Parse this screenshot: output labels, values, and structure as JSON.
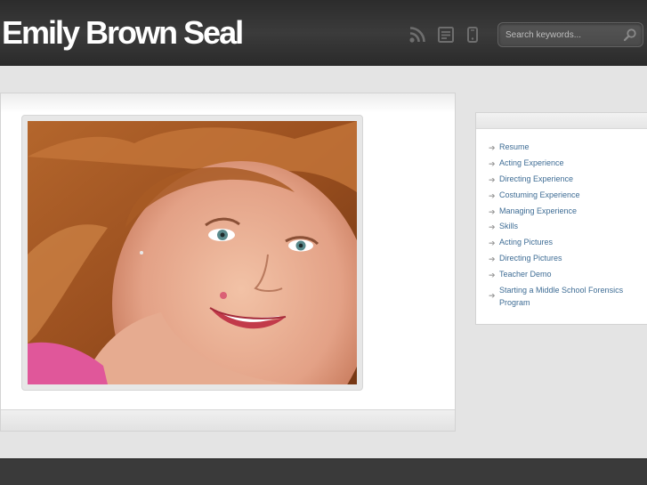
{
  "header": {
    "site_title": "Emily Brown Seal",
    "icons": [
      "rss-icon",
      "document-icon",
      "mobile-icon"
    ],
    "search": {
      "placeholder": "Search keywords..."
    }
  },
  "main": {
    "photo": {
      "subject": "portrait-photo"
    }
  },
  "sidebar": {
    "items": [
      {
        "label": "Resume"
      },
      {
        "label": "Acting Experience"
      },
      {
        "label": "Directing Experience"
      },
      {
        "label": "Costuming Experience"
      },
      {
        "label": "Managing Experience"
      },
      {
        "label": "Skills"
      },
      {
        "label": "Acting Pictures"
      },
      {
        "label": "Directing Pictures"
      },
      {
        "label": "Teacher Demo"
      },
      {
        "label": "Starting a Middle School Forensics Program"
      }
    ]
  },
  "colors": {
    "header_bg": "#333333",
    "link": "#3f6d95",
    "page_bg": "#e4e4e4",
    "footer_bg": "#3a3a3a"
  }
}
